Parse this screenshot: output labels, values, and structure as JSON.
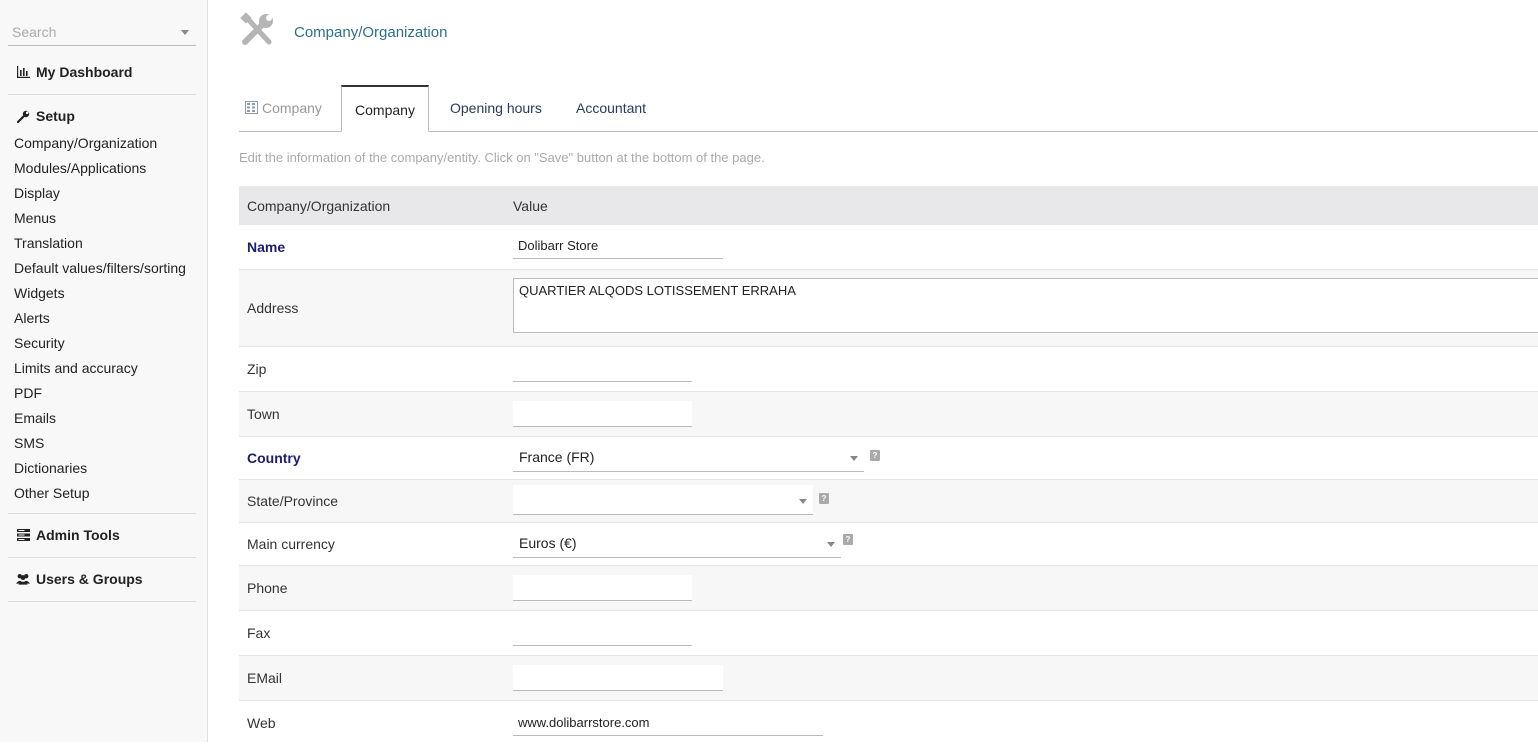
{
  "sidebar": {
    "search_placeholder": "Search",
    "dashboard": "My Dashboard",
    "setup": "Setup",
    "setup_items": [
      "Company/Organization",
      "Modules/Applications",
      "Display",
      "Menus",
      "Translation",
      "Default values/filters/sorting",
      "Widgets",
      "Alerts",
      "Security",
      "Limits and accuracy",
      "PDF",
      "Emails",
      "SMS",
      "Dictionaries",
      "Other Setup"
    ],
    "admin_tools": "Admin Tools",
    "users_groups": "Users & Groups"
  },
  "header": {
    "title": "Company/Organization"
  },
  "tabs": [
    {
      "label": "Company"
    },
    {
      "label": "Company"
    },
    {
      "label": "Opening hours"
    },
    {
      "label": "Accountant"
    }
  ],
  "hint": "Edit the information of the company/entity. Click on \"Save\" button at the bottom of the page.",
  "table": {
    "col1": "Company/Organization",
    "col2": "Value",
    "name_label": "Name",
    "name_value": "Dolibarr Store",
    "address_label": "Address",
    "address_value": "QUARTIER ALQODS LOTISSEMENT ERRAHA",
    "zip_label": "Zip",
    "zip_value": "",
    "town_label": "Town",
    "town_value": "",
    "country_label": "Country",
    "country_value": "France (FR)",
    "state_label": "State/Province",
    "state_value": "",
    "currency_label": "Main currency",
    "currency_value": "Euros (€)",
    "phone_label": "Phone",
    "phone_value": "",
    "fax_label": "Fax",
    "fax_value": "",
    "email_label": "EMail",
    "email_value": "",
    "web_label": "Web",
    "web_value": "www.dolibarrstore.com"
  },
  "colors": {
    "title_link": "#2e6f8a",
    "required_label": "#1d1d6b",
    "table_header_bg": "#e8e8eb",
    "tab_text": "#263c5c"
  }
}
